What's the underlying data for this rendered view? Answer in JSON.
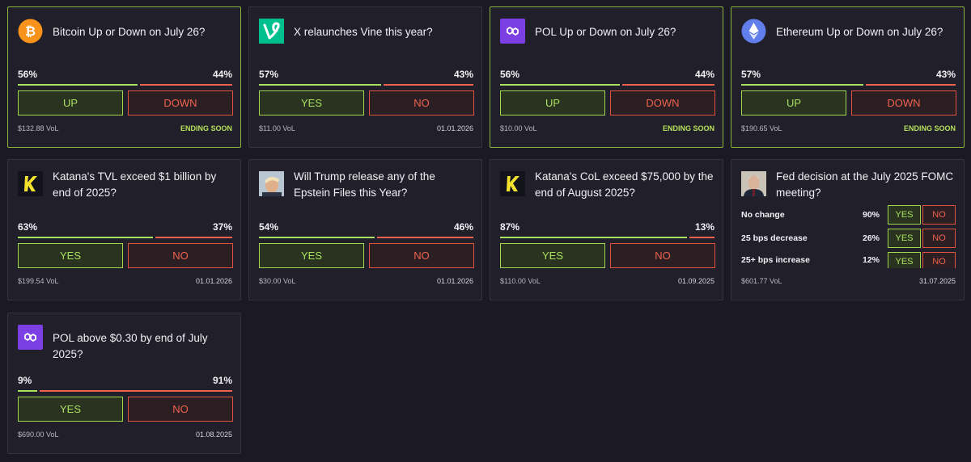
{
  "colors": {
    "background": "#1b1a24",
    "card": "#201f2a",
    "yes_green": "#a8e05f",
    "no_red": "#f0624d",
    "highlight_border": "#8bb33a"
  },
  "markets": [
    {
      "title": "Bitcoin Up or Down on July 26?",
      "icon": "bitcoin-icon",
      "yes_pct": "56%",
      "no_pct": "44%",
      "yes_fraction": 0.56,
      "yes_label": "UP",
      "no_label": "DOWN",
      "volume": "$132.88 VoL",
      "status": "ENDING SOON"
    },
    {
      "title": "X relaunches Vine this year?",
      "icon": "vine-icon",
      "yes_pct": "57%",
      "no_pct": "43%",
      "yes_fraction": 0.57,
      "yes_label": "YES",
      "no_label": "NO",
      "volume": "$11.00 VoL",
      "status": "01.01.2026"
    },
    {
      "title": "POL Up or Down on July 26?",
      "icon": "polygon-icon",
      "yes_pct": "56%",
      "no_pct": "44%",
      "yes_fraction": 0.56,
      "yes_label": "UP",
      "no_label": "DOWN",
      "volume": "$10.00 VoL",
      "status": "ENDING SOON"
    },
    {
      "title": "Ethereum Up or Down on July 26?",
      "icon": "ethereum-icon",
      "yes_pct": "57%",
      "no_pct": "43%",
      "yes_fraction": 0.57,
      "yes_label": "UP",
      "no_label": "DOWN",
      "volume": "$190.65 VoL",
      "status": "ENDING SOON"
    },
    {
      "title": "Katana's TVL exceed $1 billion by end of 2025?",
      "icon": "katana-icon",
      "yes_pct": "63%",
      "no_pct": "37%",
      "yes_fraction": 0.63,
      "yes_label": "YES",
      "no_label": "NO",
      "volume": "$199.54 VoL",
      "status": "01.01.2026"
    },
    {
      "title": "Will Trump release any of the Epstein Files this Year?",
      "icon": "trump-avatar-icon",
      "yes_pct": "54%",
      "no_pct": "46%",
      "yes_fraction": 0.54,
      "yes_label": "YES",
      "no_label": "NO",
      "volume": "$30.00 VoL",
      "status": "01.01.2026"
    },
    {
      "title": "Katana's CoL exceed $75,000 by the end of August 2025?",
      "icon": "katana-icon",
      "yes_pct": "87%",
      "no_pct": "13%",
      "yes_fraction": 0.87,
      "yes_label": "YES",
      "no_label": "NO",
      "volume": "$110.00 VoL",
      "status": "01.09.2025"
    },
    {
      "title": "POL above $0.30 by end of July 2025?",
      "icon": "polygon-icon",
      "yes_pct": "9%",
      "no_pct": "91%",
      "yes_fraction": 0.09,
      "yes_label": "YES",
      "no_label": "NO",
      "volume": "$690.00 VoL",
      "status": "01.08.2025"
    }
  ],
  "fed": {
    "title": "Fed decision at the July 2025 FOMC meeting?",
    "icon": "powell-avatar-icon",
    "yes_label": "YES",
    "no_label": "NO",
    "options": [
      {
        "label": "No change",
        "pct": "90%"
      },
      {
        "label": "25 bps decrease",
        "pct": "26%"
      },
      {
        "label": "25+ bps increase",
        "pct": "12%"
      }
    ],
    "volume": "$601.77 VoL",
    "status": "31.07.2025"
  }
}
